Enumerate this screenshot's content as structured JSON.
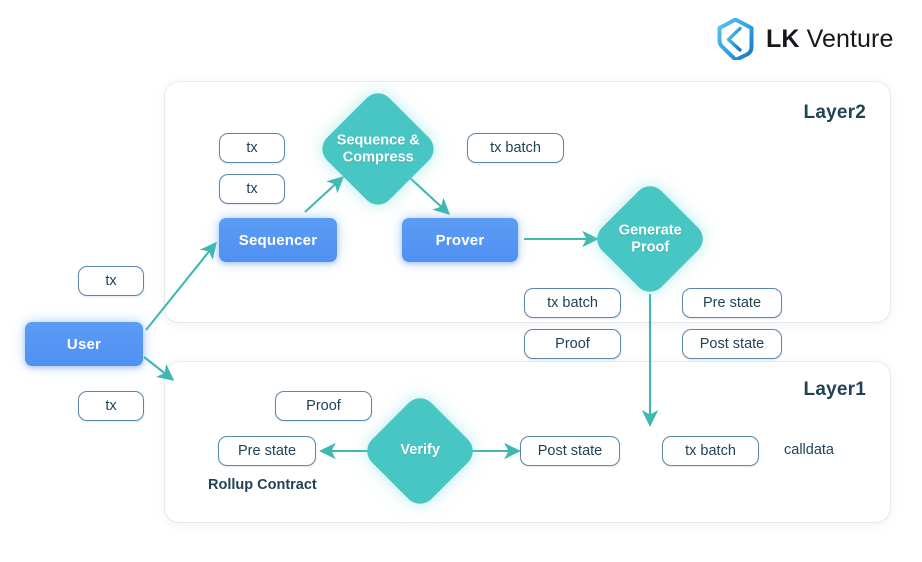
{
  "brand": {
    "logo_icon": "lk-hexagon-logo-icon",
    "name_bold": "LK",
    "name_light": "Venture",
    "logo_color": "#2f9fe3",
    "text_color": "#16181c"
  },
  "theme": {
    "blue_node": "#4f90f2",
    "teal_node": "#48c6c4",
    "chip_border": "#5b86ad",
    "title_color": "#1f4257",
    "arrow_color": "#3fb8b0",
    "page_background": "#ffffff",
    "panel_background": "#ffffff"
  },
  "layer2": {
    "title": "Layer2",
    "nodes": {
      "tx_top": "tx",
      "tx_bottom": "tx",
      "sequencer": "Sequencer",
      "sequence_compress": "Sequence &\nCompress",
      "tx_batch_top": "tx batch",
      "prover": "Prover",
      "generate_proof": "Generate\nProof",
      "tx_batch_mid": "tx batch",
      "pre_state": "Pre state"
    }
  },
  "straddle": {
    "proof": "Proof",
    "post_state": "Post state"
  },
  "layer1": {
    "title": "Layer1",
    "nodes": {
      "proof": "Proof",
      "pre_state": "Pre state",
      "verify": "Verify",
      "post_state": "Post state",
      "tx_batch": "tx batch",
      "calldata": "calldata",
      "rollup_contract": "Rollup Contract"
    }
  },
  "outside": {
    "tx_upper": "tx",
    "user": "User",
    "tx_lower": "tx"
  }
}
